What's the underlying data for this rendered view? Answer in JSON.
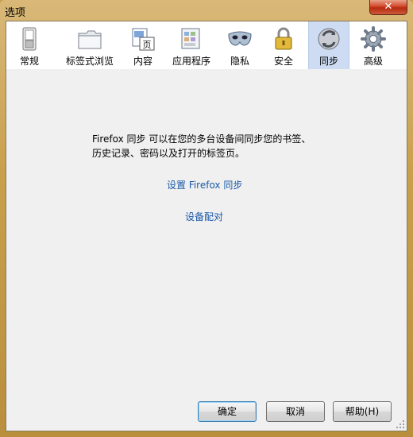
{
  "window": {
    "title": "选项",
    "close_label": "✕"
  },
  "tabs": [
    {
      "id": "general",
      "label": "常规",
      "icon": "switch-icon",
      "selected": false
    },
    {
      "id": "tabs",
      "label": "标签式浏览",
      "icon": "tabs-folder-icon",
      "selected": false
    },
    {
      "id": "content",
      "label": "内容",
      "icon": "page-content-icon",
      "selected": false
    },
    {
      "id": "applications",
      "label": "应用程序",
      "icon": "applications-icon",
      "selected": false
    },
    {
      "id": "privacy",
      "label": "隐私",
      "icon": "mask-icon",
      "selected": false
    },
    {
      "id": "security",
      "label": "安全",
      "icon": "padlock-icon",
      "selected": false
    },
    {
      "id": "sync",
      "label": "同步",
      "icon": "sync-icon",
      "selected": true
    },
    {
      "id": "advanced",
      "label": "高级",
      "icon": "gear-icon",
      "selected": false
    }
  ],
  "content_icon_glyph": "页",
  "sync": {
    "description_line1": "Firefox 同步 可以在您的多台设备间同步您的书签、",
    "description_line2": "历史记录、密码以及打开的标签页。",
    "setup_link": "设置 Firefox 同步",
    "pair_link": "设备配对"
  },
  "buttons": {
    "ok": "确定",
    "cancel": "取消",
    "help": "帮助(H)"
  },
  "colors": {
    "frame": "#c9a24f",
    "selected_tab": "#cddcf2",
    "link": "#1a5aa8",
    "panel": "#f0f0f0"
  }
}
